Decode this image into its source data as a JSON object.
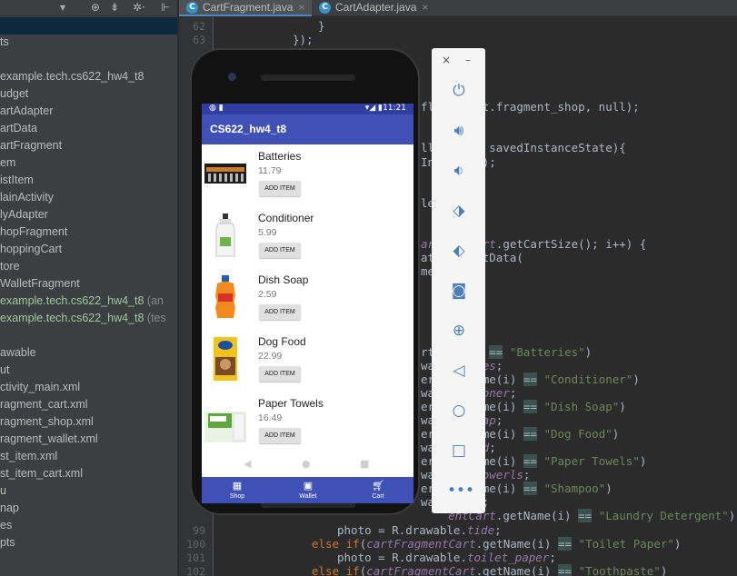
{
  "project_panel": {
    "items": [
      {
        "label": "ts"
      },
      {
        "label": "example.tech.cs622_hw4_t8"
      },
      {
        "label": "udget"
      },
      {
        "label": "artAdapter"
      },
      {
        "label": "artData"
      },
      {
        "label": "artFragment"
      },
      {
        "label": "em"
      },
      {
        "label": "istItem"
      },
      {
        "label": "lainActivity"
      },
      {
        "label": "lyAdapter"
      },
      {
        "label": "hopFragment"
      },
      {
        "label": "hoppingCart"
      },
      {
        "label": "tore"
      },
      {
        "label": "WalletFragment"
      },
      {
        "label": "example.tech.cs622_hw4_t8",
        "suffix": " (an"
      },
      {
        "label": "example.tech.cs622_hw4_t8",
        "suffix": " (tes"
      },
      {
        "label": "awable"
      },
      {
        "label": "ut"
      },
      {
        "label": "ctivity_main.xml"
      },
      {
        "label": "ragment_cart.xml"
      },
      {
        "label": "ragment_shop.xml"
      },
      {
        "label": "ragment_wallet.xml"
      },
      {
        "label": "st_item.xml"
      },
      {
        "label": "st_item_cart.xml"
      },
      {
        "label": "u"
      },
      {
        "label": "nap"
      },
      {
        "label": "es"
      },
      {
        "label": "pts"
      }
    ]
  },
  "tabs": [
    {
      "label": "CartFragment.java",
      "active": true
    },
    {
      "label": "CartAdapter.java",
      "active": false
    }
  ],
  "editor": {
    "line_numbers": [
      "62",
      "63",
      "99",
      "100",
      "101",
      "102"
    ]
  },
  "app": {
    "status_time": "11:21",
    "title": "CS622_hw4_t8",
    "items": [
      {
        "name": "Batteries",
        "price": "11.79",
        "button": "ADD ITEM"
      },
      {
        "name": "Conditioner",
        "price": "5.99",
        "button": "ADD ITEM"
      },
      {
        "name": "Dish Soap",
        "price": "2.59",
        "button": "ADD ITEM"
      },
      {
        "name": "Dog Food",
        "price": "22.99",
        "button": "ADD ITEM"
      },
      {
        "name": "Paper Towels",
        "price": "16.49",
        "button": "ADD ITEM"
      }
    ],
    "bottom_nav": [
      {
        "label": "Shop",
        "icon": "store-icon"
      },
      {
        "label": "Wallet",
        "icon": "wallet-icon"
      },
      {
        "label": "Cart",
        "icon": "cart-icon"
      }
    ]
  },
  "colors": {
    "primary": "#3f51b5",
    "primary_dark": "#303f9f",
    "ide_bg": "#2b2b2b"
  }
}
